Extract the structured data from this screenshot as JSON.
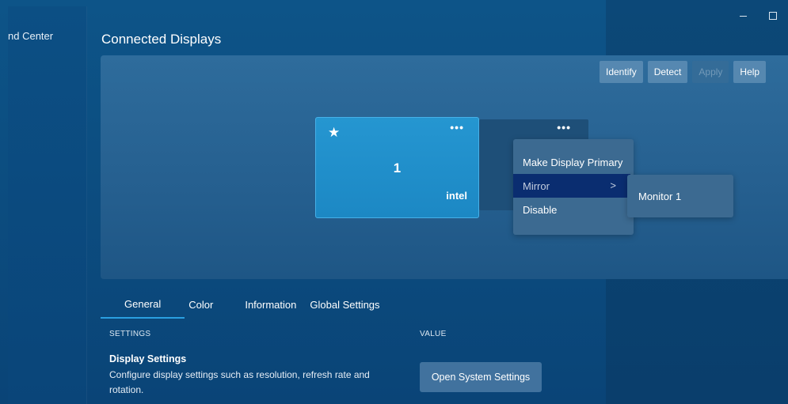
{
  "app": {
    "sidebar_title": "nd Center",
    "window_controls": {
      "minimize_icon": "minimize-icon",
      "maximize_icon": "maximize-icon"
    }
  },
  "page": {
    "title": "Connected Displays"
  },
  "toolbar": {
    "identify_label": "Identify",
    "detect_label": "Detect",
    "apply_label": "Apply",
    "help_label": "Help"
  },
  "displays": {
    "primary": {
      "star_icon": "star-icon",
      "options_icon": "•••",
      "number": "1",
      "brand": "intel"
    },
    "secondary": {
      "options_icon": "•••"
    }
  },
  "context_menu": {
    "items": [
      {
        "label": "Make Display Primary"
      },
      {
        "label": "Mirror",
        "chevron": ">"
      },
      {
        "label": "Disable"
      }
    ],
    "submenu": {
      "items": [
        {
          "label": "Monitor 1"
        }
      ]
    }
  },
  "tabs": [
    {
      "label": "General",
      "active": true
    },
    {
      "label": "Color"
    },
    {
      "label": "Information"
    },
    {
      "label": "Global Settings"
    }
  ],
  "settings_table": {
    "col_settings": "SETTINGS",
    "col_value": "VALUE",
    "rows": [
      {
        "title": "Display Settings",
        "description": "Configure display settings such as resolution, refresh rate and rotation.",
        "button_label": "Open System Settings"
      }
    ]
  },
  "colors": {
    "accent": "#2a9fe0",
    "primary_monitor": "#1c88c4",
    "menu_active": "#0a2d70",
    "background": "#0c4d80"
  }
}
